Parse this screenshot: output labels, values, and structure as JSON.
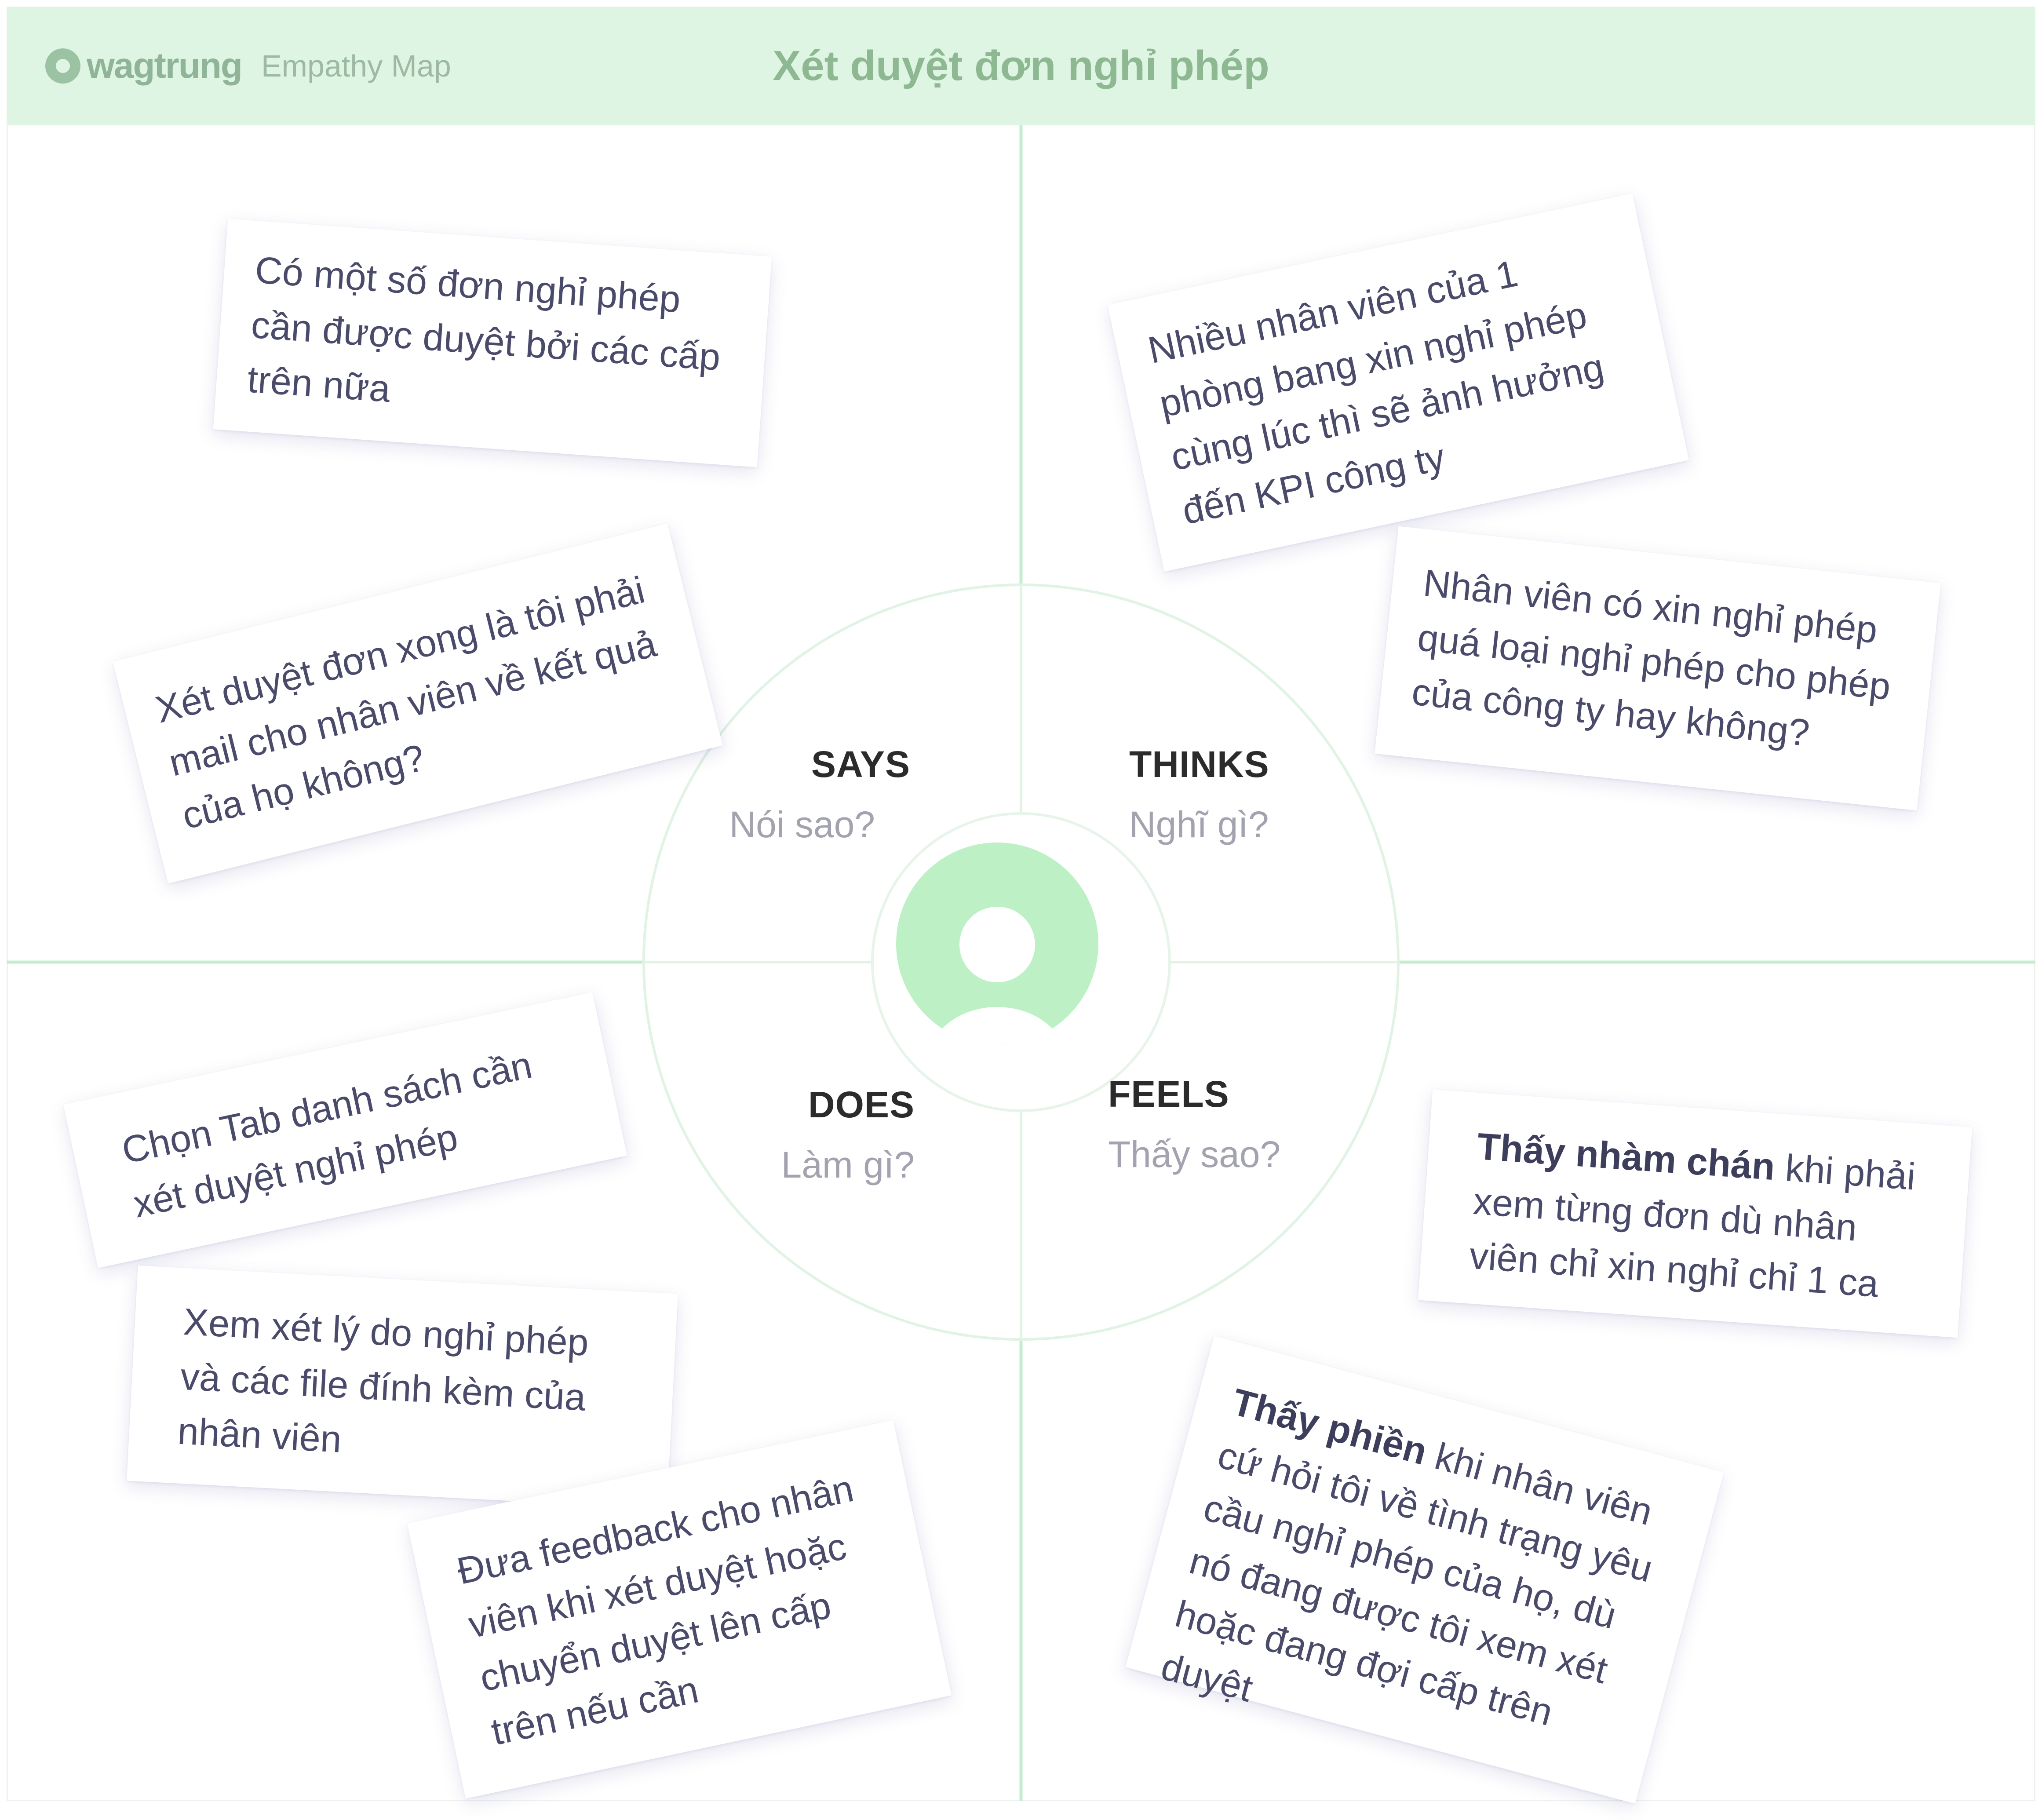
{
  "header": {
    "brand": "wagtrung",
    "subtitle": "Empathy Map",
    "title": "Xét duyệt đơn nghỉ phép"
  },
  "quadrants": {
    "says": {
      "title": "SAYS",
      "subtitle": "Nói sao?"
    },
    "thinks": {
      "title": "THINKS",
      "subtitle": "Nghĩ gì?"
    },
    "does": {
      "title": "DOES",
      "subtitle": "Làm gì?"
    },
    "feels": {
      "title": "FEELS",
      "subtitle": "Thấy sao?"
    }
  },
  "notes": {
    "says_1": "Có một số đơn nghỉ phép cần được duyệt bởi các cấp trên nữa",
    "says_2": "Xét duyệt đơn xong là tôi phải mail cho nhân viên về kết quả của họ không?",
    "thinks_1": "Nhiều nhân viên của 1 phòng bang xin nghỉ phép cùng lúc thì sẽ ảnh hưởng đến KPI công ty",
    "thinks_2": "Nhân viên có xin nghỉ phép quá loại nghỉ phép cho phép của công ty hay không?",
    "does_1": "Chọn Tab danh sách cần xét duyệt nghỉ phép",
    "does_2": "Xem xét lý do nghỉ phép và các file đính kèm của nhân viên",
    "does_3": "Đưa feedback cho nhân viên khi xét duyệt hoặc chuyển duyệt lên cấp trên nếu cần",
    "feels_1_bold": "Thấy nhàm chán",
    "feels_1_rest": " khi phải xem từng đơn dù nhân viên chỉ xin nghỉ chỉ 1 ca",
    "feels_2_bold": "Thấy phiền",
    "feels_2_rest": " khi nhân viên cứ hỏi tôi về tình trạng yêu cầu nghỉ phép của họ, dù nó đang được tôi xem xét hoặc đang đợi cấp trên duyệt"
  },
  "colors": {
    "header_bg": "#dff5e3",
    "grid_line": "#c6ecd0",
    "avatar": "#bdf0c4",
    "note_text": "#4a4a6a"
  },
  "icons": {
    "brand_logo": "circle-logo-icon",
    "persona": "user-avatar-icon"
  }
}
